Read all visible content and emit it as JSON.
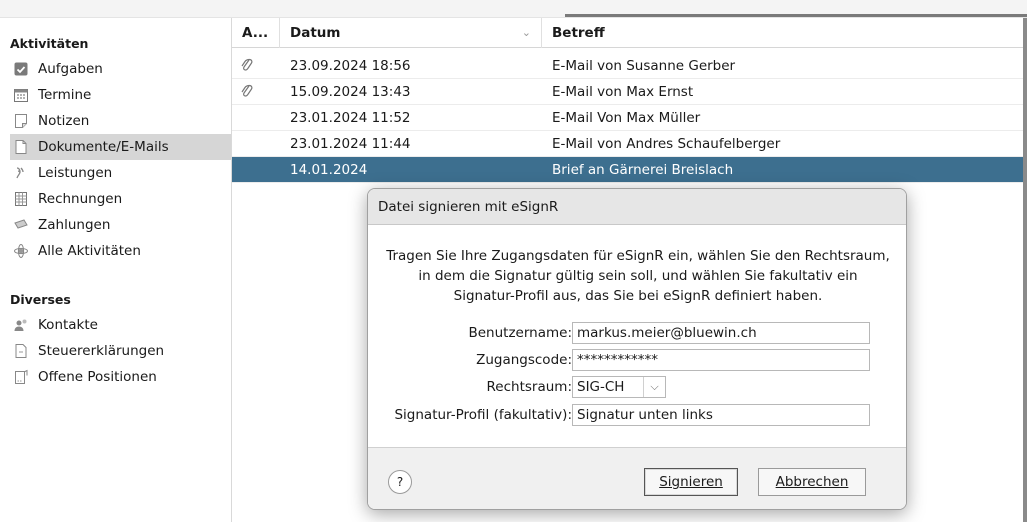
{
  "sidebar": {
    "sections": [
      {
        "title": "Aktivitäten",
        "items": [
          {
            "label": "Aufgaben",
            "icon": "task-icon"
          },
          {
            "label": "Termine",
            "icon": "calendar-icon"
          },
          {
            "label": "Notizen",
            "icon": "note-icon"
          },
          {
            "label": "Dokumente/E-Mails",
            "icon": "document-icon",
            "selected": true
          },
          {
            "label": "Leistungen",
            "icon": "services-icon"
          },
          {
            "label": "Rechnungen",
            "icon": "invoice-icon"
          },
          {
            "label": "Zahlungen",
            "icon": "payment-icon"
          },
          {
            "label": "Alle Aktivitäten",
            "icon": "all-activities-icon"
          }
        ]
      },
      {
        "title": "Diverses",
        "items": [
          {
            "label": "Kontakte",
            "icon": "contacts-icon"
          },
          {
            "label": "Steuererklärungen",
            "icon": "tax-return-icon"
          },
          {
            "label": "Offene Positionen",
            "icon": "open-items-icon"
          }
        ]
      }
    ]
  },
  "table": {
    "columns": [
      "A...",
      "Datum",
      "Betreff"
    ],
    "rows": [
      {
        "attachment": true,
        "datum": "23.09.2024 18:56",
        "betreff": "E-Mail von Susanne Gerber"
      },
      {
        "attachment": true,
        "datum": "15.09.2024 13:43",
        "betreff": "E-Mail von Max Ernst"
      },
      {
        "attachment": false,
        "datum": "23.01.2024 11:52",
        "betreff": "E-Mail Von Max Müller"
      },
      {
        "attachment": false,
        "datum": "23.01.2024 11:44",
        "betreff": "E-Mail von Andres Schaufelberger"
      },
      {
        "attachment": false,
        "datum": "14.01.2024",
        "betreff": "Brief an Gärnerei Breislach",
        "selected": true
      }
    ]
  },
  "dialog": {
    "title": "Datei signieren mit eSignR",
    "intro_lines": [
      "Tragen Sie Ihre Zugangsdaten für eSignR ein, wählen Sie den Rechtsraum,",
      "in dem die Signatur gültig sein soll, und wählen Sie fakultativ ein",
      "Signatur-Profil aus, das Sie bei eSignR definiert haben."
    ],
    "fields": {
      "username_label": "Benutzername:",
      "username_value": "markus.meier@bluewin.ch",
      "code_label": "Zugangscode:",
      "code_value": "************",
      "jurisdiction_label": "Rechtsraum:",
      "jurisdiction_value": "SIG-CH",
      "profile_label": "Signatur-Profil (fakultativ):",
      "profile_value": "Signatur unten links"
    },
    "help_label": "?",
    "sign_button": "Signieren",
    "cancel_button": "Abbrechen"
  }
}
